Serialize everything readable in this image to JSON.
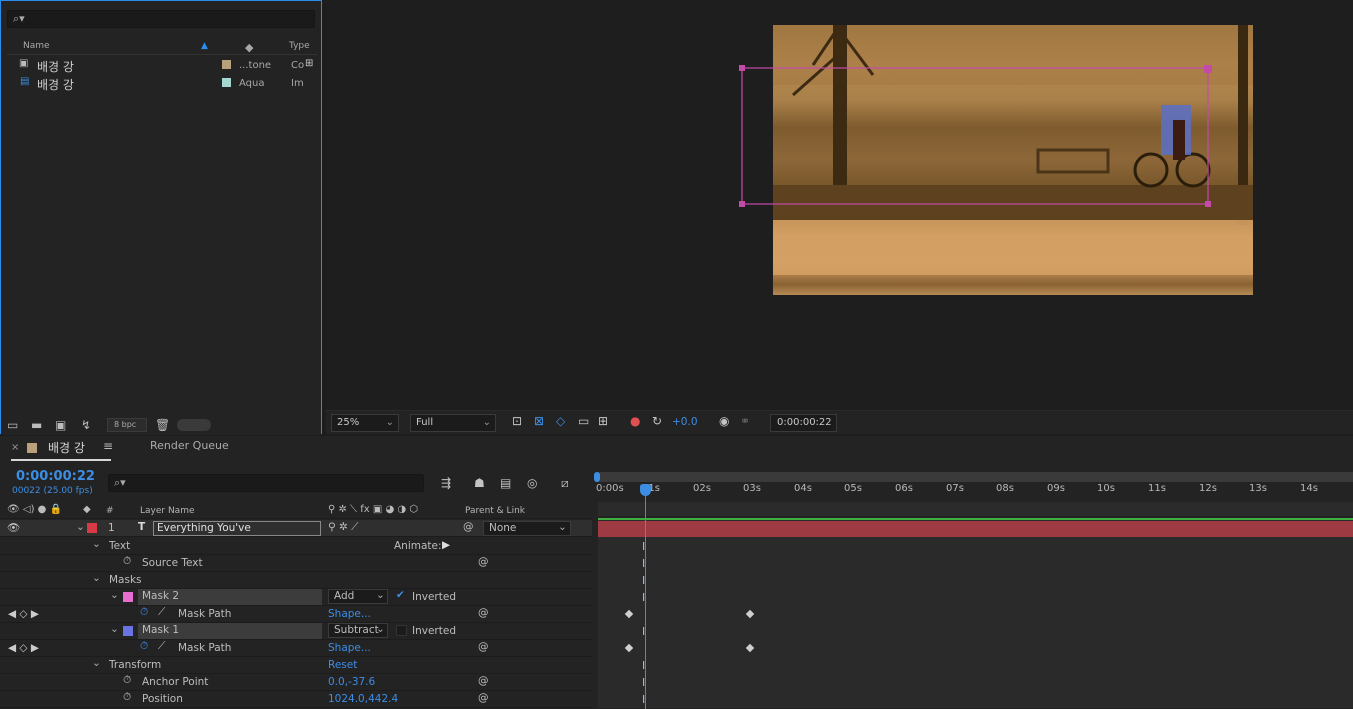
{
  "project": {
    "search_placeholder": "",
    "columns": {
      "name": "Name",
      "type": "Type"
    },
    "items": [
      {
        "name": "배경 강",
        "label": "...tone",
        "type": "Co",
        "swatch": "#b8a07a"
      },
      {
        "name": "배경 강",
        "label": "Aqua",
        "type": "Im",
        "swatch": "#a4d8d0"
      }
    ],
    "bpc": "8 bpc"
  },
  "viewer": {
    "zoom": "25%",
    "resolution": "Full",
    "exposure": "+0.0",
    "timecode": "0:00:00:22"
  },
  "timeline": {
    "tabs": {
      "comp": "배경 강",
      "render_queue": "Render Queue"
    },
    "current_time": "0:00:00:22",
    "frame_info": "00022 (25.00 fps)",
    "headers": {
      "layer_name": "Layer Name",
      "hash": "#",
      "parent": "Parent & Link"
    },
    "ruler": [
      "0:00s",
      "01s",
      "02s",
      "03s",
      "04s",
      "05s",
      "06s",
      "07s",
      "08s",
      "09s",
      "10s",
      "11s",
      "12s",
      "13s",
      "14s"
    ],
    "layer": {
      "index": "1",
      "name": "Everything You've",
      "parent": "None"
    },
    "props": {
      "text": "Text",
      "animate": "Animate:",
      "source_text": "Source Text",
      "masks": "Masks",
      "mask2": "Mask 2",
      "mask2_mode": "Add",
      "inverted": "Inverted",
      "mask_path": "Mask Path",
      "shape": "Shape...",
      "mask1": "Mask 1",
      "mask1_mode": "Subtract",
      "transform": "Transform",
      "reset": "Reset",
      "anchor": "Anchor Point",
      "anchor_val": "0.0,-37.6",
      "position": "Position",
      "position_val": "1024.0,442.4"
    }
  },
  "colors": {
    "accent": "#2d8ceb",
    "mask_outline": "#c44aa8",
    "layer_bar": "#9e3a42",
    "mask2_swatch": "#e86dd1",
    "mask1_swatch": "#6a74e0"
  }
}
